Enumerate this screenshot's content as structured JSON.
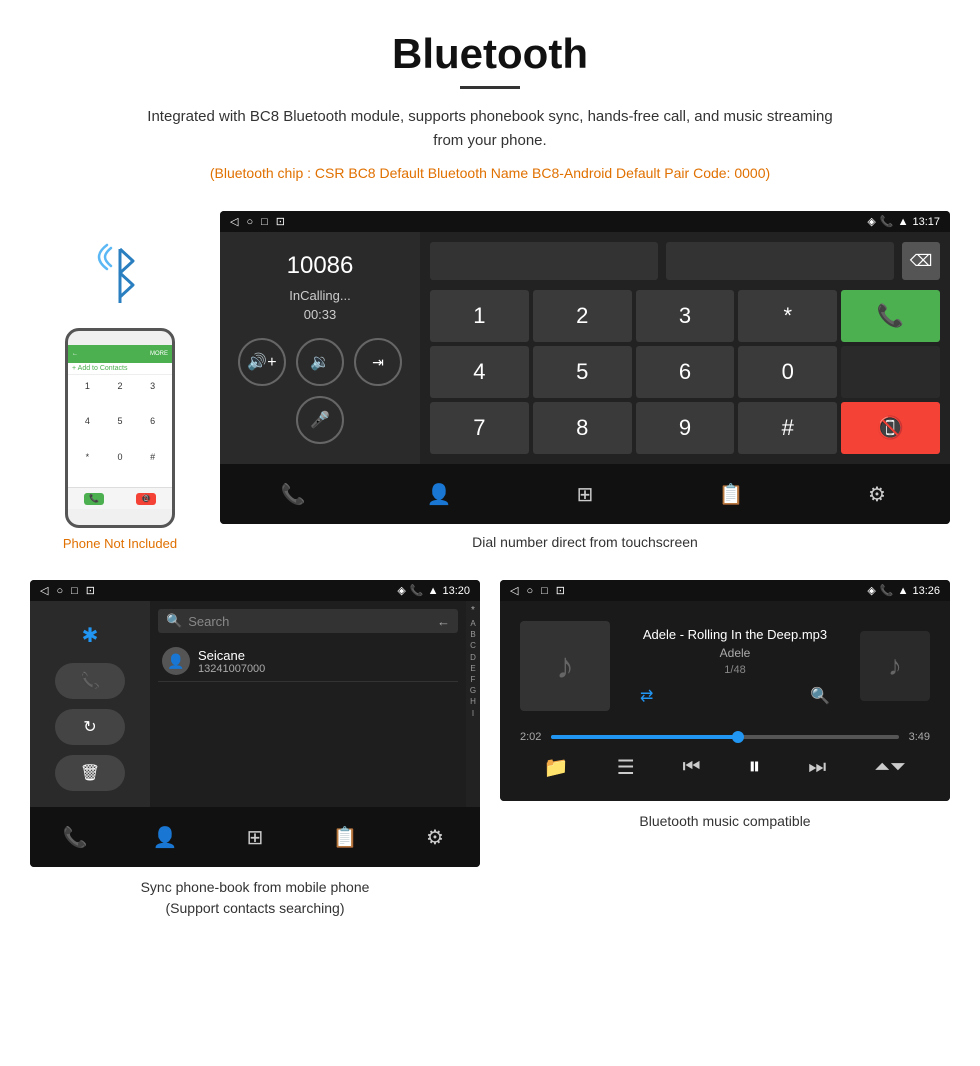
{
  "header": {
    "title": "Bluetooth",
    "description": "Integrated with BC8 Bluetooth module, supports phonebook sync, hands-free call, and music streaming from your phone.",
    "orange_text": "(Bluetooth chip : CSR BC8    Default Bluetooth Name BC8-Android    Default Pair Code: 0000)"
  },
  "dialer_screenshot": {
    "status_time": "13:17",
    "call_number": "10086",
    "call_status": "InCalling...",
    "call_duration": "00:33",
    "numpad": {
      "keys": [
        "1",
        "2",
        "3",
        "*",
        "4",
        "5",
        "6",
        "0",
        "7",
        "8",
        "9",
        "#"
      ]
    },
    "caption": "Dial number direct from touchscreen"
  },
  "phonebook_screenshot": {
    "status_time": "13:20",
    "search_placeholder": "Search",
    "contact_name": "Seicane",
    "contact_number": "13241007000",
    "alphabet": [
      "*",
      "A",
      "B",
      "C",
      "D",
      "E",
      "F",
      "G",
      "H",
      "I"
    ],
    "caption_line1": "Sync phone-book from mobile phone",
    "caption_line2": "(Support contacts searching)"
  },
  "music_screenshot": {
    "status_time": "13:26",
    "song_title": "Adele - Rolling In the Deep.mp3",
    "artist": "Adele",
    "track_info": "1/48",
    "time_current": "2:02",
    "time_total": "3:49",
    "caption": "Bluetooth music compatible"
  },
  "phone": {
    "not_included_text": "Phone Not Included",
    "numbers": [
      "1",
      "2",
      "3",
      "4",
      "5",
      "6",
      "*",
      "0",
      "#"
    ]
  }
}
